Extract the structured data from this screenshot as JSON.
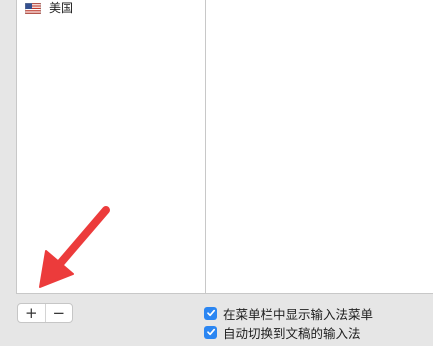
{
  "input_sources": {
    "items": [
      {
        "label": "美国",
        "icon": "us-flag-icon"
      }
    ]
  },
  "controls": {
    "add_label": "+",
    "remove_label": "−"
  },
  "options": {
    "show_in_menu_bar": {
      "label": "在菜单栏中显示输入法菜单",
      "checked": true
    },
    "auto_switch": {
      "label": "自动切换到文稿的输入法",
      "checked": true
    }
  },
  "colors": {
    "checkbox": "#2b86f2",
    "annotation_arrow": "#ec3b3b"
  }
}
